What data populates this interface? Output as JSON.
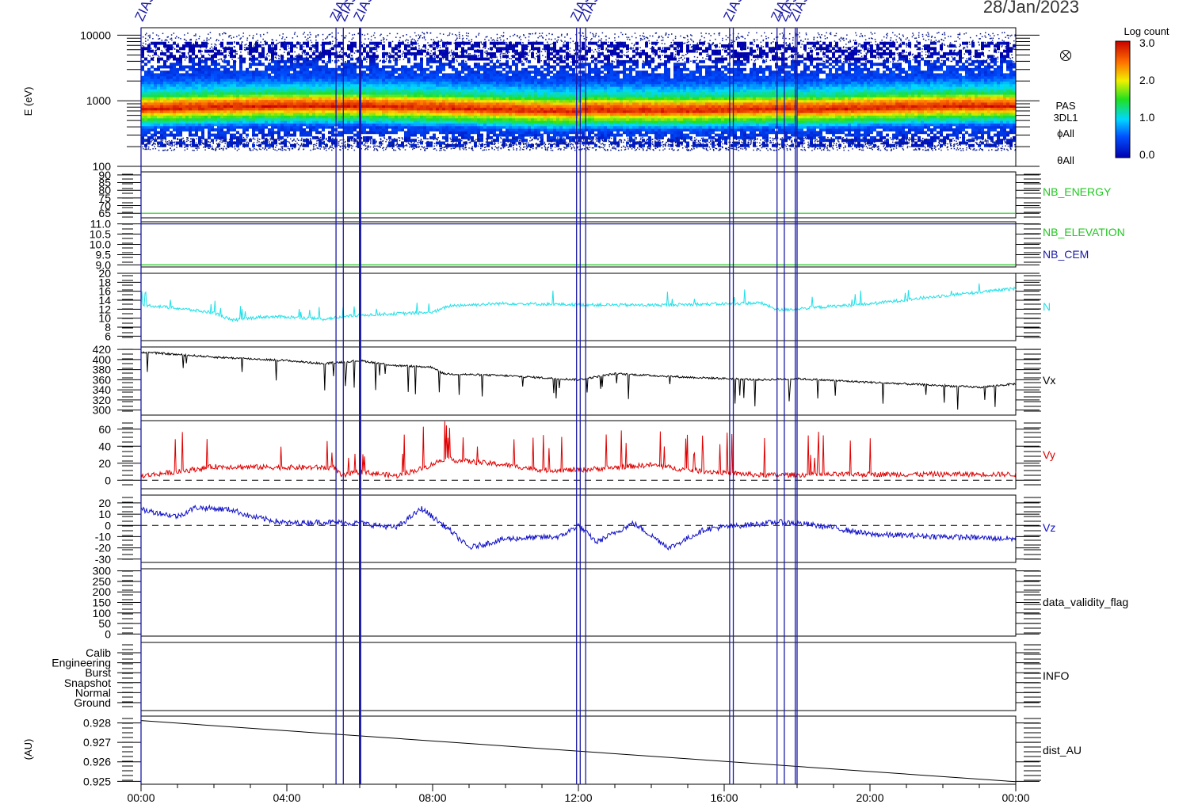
{
  "header": {
    "date": "28/Jan/2023"
  },
  "colorbar": {
    "title": "Log count",
    "ticks": [
      "3.0",
      "2.0",
      "1.0",
      "0.0"
    ]
  },
  "markers": {
    "label": "ZIAS",
    "hours": [
      0.0,
      5.35,
      5.55,
      6.0,
      6.02,
      11.95,
      12.05,
      12.2,
      16.15,
      16.25,
      17.45,
      17.65,
      17.95,
      18.0
    ]
  },
  "chart_data": [
    {
      "type": "heatmap",
      "ylabel": "E (eV)",
      "y_scale": "log",
      "ylim": [
        100,
        13000
      ],
      "y_ticks": [
        "10000",
        "1000",
        "100"
      ],
      "side_labels": [
        "PAS",
        "3DL1",
        "ϕAll",
        "θAll"
      ],
      "band_levels_by_log10_E": [
        {
          "logE": 2.35,
          "level": 0.2
        },
        {
          "logE": 2.55,
          "level": 0.45
        },
        {
          "logE": 2.75,
          "level": 1.9
        },
        {
          "logE": 2.85,
          "level": 2.9
        },
        {
          "logE": 2.95,
          "level": 2.4
        },
        {
          "logE": 3.05,
          "level": 1.4
        },
        {
          "logE": 3.15,
          "level": 1.0
        },
        {
          "logE": 3.3,
          "level": 0.5
        },
        {
          "logE": 3.6,
          "level": 0.2
        }
      ],
      "colors": {
        "low": "#0b1fa8",
        "mid": "#1eea2a",
        "high": "#d90000",
        "noise": "#0a1b8c"
      }
    },
    {
      "type": "line",
      "y_ticks": [
        "90",
        "85",
        "80",
        "75",
        "70",
        "65"
      ],
      "ylim": [
        62,
        92
      ],
      "series": [
        {
          "name": "NB_ENERGY",
          "color": "#20c820",
          "values": [
            {
              "x": 0,
              "y": 65
            },
            {
              "x": 24,
              "y": 65
            }
          ]
        }
      ]
    },
    {
      "type": "line",
      "y_ticks": [
        "11.0",
        "10.5",
        "10.0",
        "9.5",
        "9.0"
      ],
      "ylim": [
        8.9,
        11.1
      ],
      "series": [
        {
          "name": "NB_ELEVATION",
          "color": "#20c820",
          "values": [
            {
              "x": 0,
              "y": 9.0
            },
            {
              "x": 24,
              "y": 9.0
            }
          ]
        },
        {
          "name": "NB_CEM",
          "color": "#1a1aa6",
          "values": [
            {
              "x": 0,
              "y": 11.0
            },
            {
              "x": 24,
              "y": 11.0
            }
          ]
        }
      ]
    },
    {
      "type": "line",
      "y_ticks": [
        "20",
        "18",
        "16",
        "14",
        "12",
        "10",
        "8",
        "6"
      ],
      "ylim": [
        5,
        20
      ],
      "series": [
        {
          "name": "N",
          "color": "#20e0e8",
          "noise": 0.35,
          "spikes": 2.5,
          "values": [
            {
              "x": 0,
              "y": 13
            },
            {
              "x": 1,
              "y": 12.2
            },
            {
              "x": 2,
              "y": 11.2
            },
            {
              "x": 2.5,
              "y": 9.5
            },
            {
              "x": 3.3,
              "y": 10.3
            },
            {
              "x": 4,
              "y": 10.3
            },
            {
              "x": 5,
              "y": 9.8
            },
            {
              "x": 6,
              "y": 10.7
            },
            {
              "x": 7,
              "y": 11
            },
            {
              "x": 8,
              "y": 11.3
            },
            {
              "x": 8.5,
              "y": 12.8
            },
            {
              "x": 10,
              "y": 13.3
            },
            {
              "x": 12,
              "y": 13
            },
            {
              "x": 14,
              "y": 12.9
            },
            {
              "x": 16,
              "y": 13.2
            },
            {
              "x": 17,
              "y": 13.4
            },
            {
              "x": 17.5,
              "y": 11.8
            },
            {
              "x": 18,
              "y": 12.1
            },
            {
              "x": 20,
              "y": 13.2
            },
            {
              "x": 22,
              "y": 15
            },
            {
              "x": 24,
              "y": 16.6
            }
          ]
        }
      ]
    },
    {
      "type": "line",
      "y_ticks": [
        "420",
        "400",
        "380",
        "360",
        "340",
        "320",
        "300"
      ],
      "ylim": [
        290,
        425
      ],
      "series": [
        {
          "name": "Vx",
          "color": "#000000",
          "noise": 2.0,
          "spikes": -40,
          "values": [
            {
              "x": 0,
              "y": 415
            },
            {
              "x": 2,
              "y": 405
            },
            {
              "x": 4,
              "y": 398
            },
            {
              "x": 5,
              "y": 392
            },
            {
              "x": 6,
              "y": 398
            },
            {
              "x": 7,
              "y": 388
            },
            {
              "x": 8,
              "y": 385
            },
            {
              "x": 8.3,
              "y": 372
            },
            {
              "x": 10,
              "y": 368
            },
            {
              "x": 12,
              "y": 360
            },
            {
              "x": 13,
              "y": 372
            },
            {
              "x": 15,
              "y": 365
            },
            {
              "x": 17,
              "y": 360
            },
            {
              "x": 18,
              "y": 362
            },
            {
              "x": 20,
              "y": 355
            },
            {
              "x": 23,
              "y": 345
            },
            {
              "x": 24,
              "y": 352
            }
          ]
        }
      ]
    },
    {
      "type": "line",
      "y_ticks": [
        "60",
        "40",
        "20",
        "0"
      ],
      "ylim": [
        -10,
        70
      ],
      "zero_line": true,
      "series": [
        {
          "name": "Vy",
          "color": "#e00000",
          "noise": 3.0,
          "spikes": 35,
          "values": [
            {
              "x": 0,
              "y": 5
            },
            {
              "x": 1,
              "y": 10
            },
            {
              "x": 2,
              "y": 16
            },
            {
              "x": 4,
              "y": 15
            },
            {
              "x": 5.3,
              "y": 15
            },
            {
              "x": 5.5,
              "y": 5
            },
            {
              "x": 6,
              "y": 10
            },
            {
              "x": 7,
              "y": 5
            },
            {
              "x": 7.8,
              "y": 15
            },
            {
              "x": 8.3,
              "y": 25
            },
            {
              "x": 9,
              "y": 22
            },
            {
              "x": 10,
              "y": 18
            },
            {
              "x": 11,
              "y": 12
            },
            {
              "x": 12,
              "y": 12
            },
            {
              "x": 13,
              "y": 15
            },
            {
              "x": 14,
              "y": 18
            },
            {
              "x": 15,
              "y": 12
            },
            {
              "x": 17,
              "y": 6
            },
            {
              "x": 20,
              "y": 7
            },
            {
              "x": 24,
              "y": 7
            }
          ]
        }
      ]
    },
    {
      "type": "line",
      "y_ticks": [
        "20",
        "10",
        "0",
        "-10",
        "-20",
        "-30"
      ],
      "ylim": [
        -33,
        27
      ],
      "zero_line": true,
      "series": [
        {
          "name": "Vz",
          "color": "#1010c8",
          "noise": 2.5,
          "spikes": 0,
          "values": [
            {
              "x": 0,
              "y": 14
            },
            {
              "x": 1,
              "y": 8
            },
            {
              "x": 1.5,
              "y": 16
            },
            {
              "x": 2.5,
              "y": 14
            },
            {
              "x": 3,
              "y": 8
            },
            {
              "x": 4,
              "y": 2
            },
            {
              "x": 5,
              "y": 3
            },
            {
              "x": 6,
              "y": 2
            },
            {
              "x": 7,
              "y": -2
            },
            {
              "x": 7.7,
              "y": 15
            },
            {
              "x": 8.5,
              "y": -5
            },
            {
              "x": 9,
              "y": -20
            },
            {
              "x": 10,
              "y": -12
            },
            {
              "x": 11.5,
              "y": -10
            },
            {
              "x": 12,
              "y": 0
            },
            {
              "x": 12.5,
              "y": -15
            },
            {
              "x": 13.5,
              "y": 2
            },
            {
              "x": 14.5,
              "y": -20
            },
            {
              "x": 15.5,
              "y": -3
            },
            {
              "x": 16.5,
              "y": 0
            },
            {
              "x": 17.5,
              "y": 3
            },
            {
              "x": 18,
              "y": 2
            },
            {
              "x": 19,
              "y": -2
            },
            {
              "x": 20,
              "y": -8
            },
            {
              "x": 22,
              "y": -10
            },
            {
              "x": 24,
              "y": -12
            }
          ]
        }
      ]
    },
    {
      "type": "line",
      "y_ticks": [
        "300",
        "250",
        "200",
        "150",
        "100",
        "50",
        "0"
      ],
      "ylim": [
        -10,
        310
      ],
      "series": [
        {
          "name": "data_validity_flag",
          "color": "#000000",
          "values": []
        }
      ]
    },
    {
      "type": "line",
      "y_ticks": [
        "Calib",
        "Engineering",
        "Burst",
        "Snapshot",
        "Normal",
        "Ground"
      ],
      "series": [
        {
          "name": "INFO",
          "color": "#000000",
          "values": []
        }
      ]
    },
    {
      "type": "line",
      "ylabel": "(AU)",
      "y_ticks": [
        "0.928",
        "0.927",
        "0.926",
        "0.925"
      ],
      "ylim": [
        0.92485,
        0.92835
      ],
      "series": [
        {
          "name": "dist_AU",
          "color": "#000000",
          "values": [
            {
              "x": 0,
              "y": 0.92812
            },
            {
              "x": 24,
              "y": 0.92498
            }
          ]
        }
      ]
    }
  ],
  "x_axis": {
    "labels": [
      "00:00",
      "04:00",
      "08:00",
      "12:00",
      "16:00",
      "20:00",
      "00:00"
    ]
  }
}
